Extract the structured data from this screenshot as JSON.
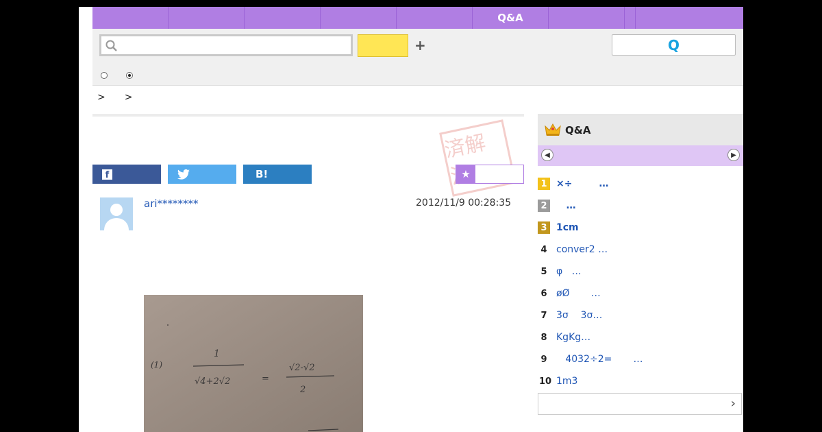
{
  "nav": {
    "items": [
      "",
      "",
      "",
      "",
      "",
      "Q&A",
      "",
      "",
      ""
    ]
  },
  "search": {
    "placeholder": "",
    "button_label": "",
    "plus_label": "+",
    "ask_button_label": "Q"
  },
  "breadcrumb": [
    ">",
    ">"
  ],
  "share": {
    "facebook_label": "f",
    "twitter_label": "",
    "hatena_label": "B!",
    "favorite_label": ""
  },
  "stamp": {
    "text": "済解決"
  },
  "question": {
    "username": "ari********",
    "timestamp": "2012/11/9  00:28:35"
  },
  "photo": {
    "line1_label": "(1)",
    "fraction_numerator": "1",
    "fraction_denominator": "√4+2√2",
    "equals": "=",
    "result_numerator": "√2-√2",
    "result_denominator": "2"
  },
  "sidebar": {
    "title": "Q&A",
    "ranking": [
      {
        "rank": "1",
        "text": "×÷        …",
        "style": "gold",
        "bold": true
      },
      {
        "rank": "2",
        "text": "   …",
        "style": "silver",
        "bold": true
      },
      {
        "rank": "3",
        "text": "1cm",
        "style": "bronze",
        "bold": true
      },
      {
        "rank": "4",
        "text": "conver2 …",
        "style": "plain",
        "bold": false
      },
      {
        "rank": "5",
        "text": "φ   …",
        "style": "plain",
        "bold": false
      },
      {
        "rank": "6",
        "text": "øØ       …",
        "style": "plain",
        "bold": false
      },
      {
        "rank": "7",
        "text": "3σ    3σ…",
        "style": "plain",
        "bold": false
      },
      {
        "rank": "8",
        "text": "KgKg…",
        "style": "plain",
        "bold": false
      },
      {
        "rank": "9",
        "text": "   4032÷2=       …",
        "style": "plain",
        "bold": false
      },
      {
        "rank": "10",
        "text": "1m3",
        "style": "plain",
        "bold": false
      }
    ],
    "more_label": ""
  },
  "colors": {
    "nav_bg": "#b07ee3",
    "search_button": "#ffe655",
    "facebook": "#3b5998",
    "twitter": "#55acee",
    "hatena": "#2c7fc1",
    "link": "#2157b5"
  }
}
